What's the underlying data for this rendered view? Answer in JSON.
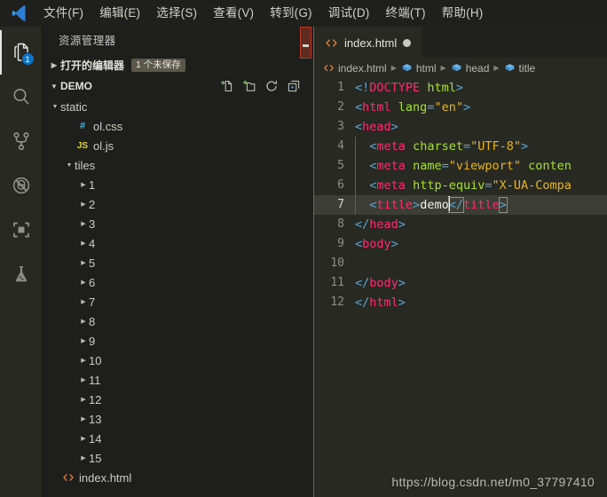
{
  "menubar": {
    "logo_icon": "vscode-logo-icon",
    "items": [
      {
        "label": "文件(F)",
        "name": "menu-file"
      },
      {
        "label": "编辑(E)",
        "name": "menu-edit"
      },
      {
        "label": "选择(S)",
        "name": "menu-selection"
      },
      {
        "label": "查看(V)",
        "name": "menu-view"
      },
      {
        "label": "转到(G)",
        "name": "menu-goto"
      },
      {
        "label": "调试(D)",
        "name": "menu-debug"
      },
      {
        "label": "终端(T)",
        "name": "menu-terminal"
      },
      {
        "label": "帮助(H)",
        "name": "menu-help"
      }
    ]
  },
  "activitybar": {
    "items": [
      {
        "icon": "files-explorer-icon",
        "name": "activity-explorer",
        "badge": "1",
        "active": true
      },
      {
        "icon": "search-icon",
        "name": "activity-search",
        "badge": "",
        "active": false
      },
      {
        "icon": "source-control-icon",
        "name": "activity-source-control",
        "badge": "",
        "active": false
      },
      {
        "icon": "run-debug-icon",
        "name": "activity-debug",
        "badge": "",
        "active": false
      },
      {
        "icon": "extensions-icon",
        "name": "activity-extensions",
        "badge": "",
        "active": false
      },
      {
        "icon": "beaker-test-icon",
        "name": "activity-test",
        "badge": "",
        "active": false
      }
    ]
  },
  "sidebar": {
    "title": "资源管理器",
    "open_editors": {
      "label": "打开的编辑器",
      "badge": "1 个未保存",
      "collapsed": true
    },
    "workspace": {
      "label": "DEMO",
      "actions": [
        {
          "icon": "new-file-icon",
          "name": "new-file-button",
          "tooltip": "新建文件"
        },
        {
          "icon": "new-folder-icon",
          "name": "new-folder-button",
          "tooltip": "新建文件夹"
        },
        {
          "icon": "refresh-icon",
          "name": "refresh-explorer-button",
          "tooltip": "刷新"
        },
        {
          "icon": "collapse-all-icon",
          "name": "collapse-all-button",
          "tooltip": "全部折叠"
        }
      ]
    },
    "tree": [
      {
        "label": "static",
        "kind": "folder",
        "expanded": true,
        "depth": 0,
        "icon": ""
      },
      {
        "label": "ol.css",
        "kind": "file",
        "expanded": null,
        "depth": 1,
        "icon": "css-icon"
      },
      {
        "label": "ol.js",
        "kind": "file",
        "expanded": null,
        "depth": 1,
        "icon": "js-icon"
      },
      {
        "label": "tiles",
        "kind": "folder",
        "expanded": true,
        "depth": 1,
        "icon": ""
      },
      {
        "label": "1",
        "kind": "folder",
        "expanded": false,
        "depth": 2,
        "icon": ""
      },
      {
        "label": "2",
        "kind": "folder",
        "expanded": false,
        "depth": 2,
        "icon": ""
      },
      {
        "label": "3",
        "kind": "folder",
        "expanded": false,
        "depth": 2,
        "icon": ""
      },
      {
        "label": "4",
        "kind": "folder",
        "expanded": false,
        "depth": 2,
        "icon": ""
      },
      {
        "label": "5",
        "kind": "folder",
        "expanded": false,
        "depth": 2,
        "icon": ""
      },
      {
        "label": "6",
        "kind": "folder",
        "expanded": false,
        "depth": 2,
        "icon": ""
      },
      {
        "label": "7",
        "kind": "folder",
        "expanded": false,
        "depth": 2,
        "icon": ""
      },
      {
        "label": "8",
        "kind": "folder",
        "expanded": false,
        "depth": 2,
        "icon": ""
      },
      {
        "label": "9",
        "kind": "folder",
        "expanded": false,
        "depth": 2,
        "icon": ""
      },
      {
        "label": "10",
        "kind": "folder",
        "expanded": false,
        "depth": 2,
        "icon": ""
      },
      {
        "label": "11",
        "kind": "folder",
        "expanded": false,
        "depth": 2,
        "icon": ""
      },
      {
        "label": "12",
        "kind": "folder",
        "expanded": false,
        "depth": 2,
        "icon": ""
      },
      {
        "label": "13",
        "kind": "folder",
        "expanded": false,
        "depth": 2,
        "icon": ""
      },
      {
        "label": "14",
        "kind": "folder",
        "expanded": false,
        "depth": 2,
        "icon": ""
      },
      {
        "label": "15",
        "kind": "folder",
        "expanded": false,
        "depth": 2,
        "icon": ""
      },
      {
        "label": "index.html",
        "kind": "file",
        "expanded": null,
        "depth": 0,
        "icon": "html-icon"
      }
    ]
  },
  "editor": {
    "tab": {
      "label": "index.html",
      "icon": "html-icon",
      "dirty": true
    },
    "breadcrumbs": [
      {
        "label": "index.html",
        "icon": "html-icon"
      },
      {
        "label": "html",
        "icon": "symbol-field-icon"
      },
      {
        "label": "head",
        "icon": "symbol-field-icon"
      },
      {
        "label": "title",
        "icon": "symbol-field-icon"
      }
    ],
    "active_line": 7,
    "lines": [
      {
        "n": "1",
        "indent": 0,
        "guide": false,
        "tokens": [
          {
            "t": "<!",
            "c": "s-br"
          },
          {
            "t": "DOCTYPE",
            "c": "s-dt"
          },
          {
            "t": " ",
            "c": "s-txt"
          },
          {
            "t": "html",
            "c": "s-att"
          },
          {
            "t": ">",
            "c": "s-br"
          }
        ]
      },
      {
        "n": "2",
        "indent": 0,
        "guide": false,
        "tokens": [
          {
            "t": "<",
            "c": "s-br"
          },
          {
            "t": "html",
            "c": "s-tag"
          },
          {
            "t": " ",
            "c": "s-txt"
          },
          {
            "t": "lang",
            "c": "s-att"
          },
          {
            "t": "=",
            "c": "s-br"
          },
          {
            "t": "\"en\"",
            "c": "s-val"
          },
          {
            "t": ">",
            "c": "s-br"
          }
        ]
      },
      {
        "n": "3",
        "indent": 0,
        "guide": false,
        "tokens": [
          {
            "t": "<",
            "c": "s-br"
          },
          {
            "t": "head",
            "c": "s-tag"
          },
          {
            "t": ">",
            "c": "s-br"
          }
        ]
      },
      {
        "n": "4",
        "indent": 1,
        "guide": true,
        "tokens": [
          {
            "t": "<",
            "c": "s-br"
          },
          {
            "t": "meta",
            "c": "s-tag"
          },
          {
            "t": " ",
            "c": "s-txt"
          },
          {
            "t": "charset",
            "c": "s-att"
          },
          {
            "t": "=",
            "c": "s-br"
          },
          {
            "t": "\"UTF-8\"",
            "c": "s-val"
          },
          {
            "t": ">",
            "c": "s-br"
          }
        ]
      },
      {
        "n": "5",
        "indent": 1,
        "guide": true,
        "tokens": [
          {
            "t": "<",
            "c": "s-br"
          },
          {
            "t": "meta",
            "c": "s-tag"
          },
          {
            "t": " ",
            "c": "s-txt"
          },
          {
            "t": "name",
            "c": "s-att"
          },
          {
            "t": "=",
            "c": "s-br"
          },
          {
            "t": "\"viewport\"",
            "c": "s-val"
          },
          {
            "t": " ",
            "c": "s-txt"
          },
          {
            "t": "conten",
            "c": "s-att"
          }
        ]
      },
      {
        "n": "6",
        "indent": 1,
        "guide": true,
        "tokens": [
          {
            "t": "<",
            "c": "s-br"
          },
          {
            "t": "meta",
            "c": "s-tag"
          },
          {
            "t": " ",
            "c": "s-txt"
          },
          {
            "t": "http-equiv",
            "c": "s-att"
          },
          {
            "t": "=",
            "c": "s-br"
          },
          {
            "t": "\"X-UA-Compa",
            "c": "s-val"
          }
        ]
      },
      {
        "n": "7",
        "indent": 1,
        "guide": true,
        "tokens": [
          {
            "t": "<",
            "c": "s-br"
          },
          {
            "t": "title",
            "c": "s-tag"
          },
          {
            "t": ">",
            "c": "s-br"
          },
          {
            "t": "demo",
            "c": "s-txt"
          },
          {
            "t": "</",
            "c": "s-br",
            "match": true
          },
          {
            "t": "title",
            "c": "s-tag"
          },
          {
            "t": ">",
            "c": "s-br",
            "match": true
          }
        ],
        "cursor_after": 4
      },
      {
        "n": "8",
        "indent": 0,
        "guide": false,
        "tokens": [
          {
            "t": "</",
            "c": "s-br"
          },
          {
            "t": "head",
            "c": "s-tag"
          },
          {
            "t": ">",
            "c": "s-br"
          }
        ]
      },
      {
        "n": "9",
        "indent": 0,
        "guide": false,
        "tokens": [
          {
            "t": "<",
            "c": "s-br"
          },
          {
            "t": "body",
            "c": "s-tag"
          },
          {
            "t": ">",
            "c": "s-br"
          }
        ]
      },
      {
        "n": "10",
        "indent": 0,
        "guide": false,
        "tokens": []
      },
      {
        "n": "11",
        "indent": 0,
        "guide": false,
        "tokens": [
          {
            "t": "</",
            "c": "s-br"
          },
          {
            "t": "body",
            "c": "s-tag"
          },
          {
            "t": ">",
            "c": "s-br"
          }
        ]
      },
      {
        "n": "12",
        "indent": 0,
        "guide": false,
        "tokens": [
          {
            "t": "</",
            "c": "s-br"
          },
          {
            "t": "html",
            "c": "s-tag"
          },
          {
            "t": ">",
            "c": "s-br"
          }
        ]
      }
    ],
    "watermark": "https://blog.csdn.net/m0_37797410"
  },
  "colors": {
    "menubar_bg": "#1f1f1d",
    "activitybar_bg": "#292924",
    "sidebar_bg": "#1e1e1c",
    "editor_bg": "#282923",
    "badge_blue": "#0e73c4",
    "accent_border": "#6d6a52",
    "active_line": "#3c3d35",
    "scroll_marker": "#b33b28"
  }
}
